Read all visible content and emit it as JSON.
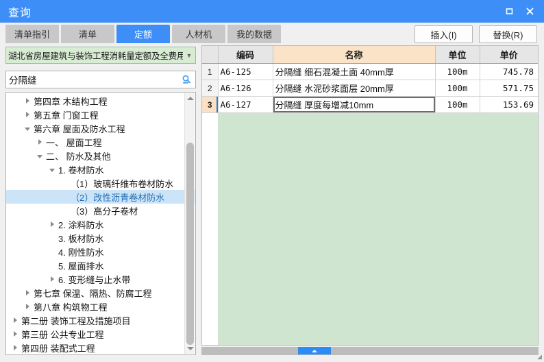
{
  "window": {
    "title": "查询",
    "controls": {
      "maximize": "maximize-icon",
      "close": "close-icon"
    }
  },
  "tabs": [
    {
      "label": "清单指引",
      "active": false
    },
    {
      "label": "清单",
      "active": false
    },
    {
      "label": "定额",
      "active": true
    },
    {
      "label": "人材机",
      "active": false
    },
    {
      "label": "我的数据",
      "active": false
    }
  ],
  "actions": {
    "insert": "插入(I)",
    "replace": "替换(R)"
  },
  "left": {
    "library_select": {
      "value": "湖北省房屋建筑与装饰工程消耗量定额及全费用",
      "arrow": "chevron-down-icon"
    },
    "search": {
      "value": "分隔缝",
      "placeholder": "",
      "icon": "search-icon"
    },
    "tree": [
      {
        "indent": 1,
        "state": "collapsed",
        "label": "第四章  木结构工程",
        "selected": false
      },
      {
        "indent": 1,
        "state": "collapsed",
        "label": "第五章  门窗工程",
        "selected": false
      },
      {
        "indent": 1,
        "state": "expanded",
        "label": "第六章  屋面及防水工程",
        "selected": false
      },
      {
        "indent": 2,
        "state": "collapsed",
        "label": "一、  屋面工程",
        "selected": false
      },
      {
        "indent": 2,
        "state": "expanded",
        "label": "二、  防水及其他",
        "selected": false
      },
      {
        "indent": 3,
        "state": "expanded",
        "label": "1.  卷材防水",
        "selected": false
      },
      {
        "indent": 4,
        "state": "leaf",
        "label": "（1）玻璃纤维布卷材防水",
        "selected": false
      },
      {
        "indent": 4,
        "state": "leaf",
        "label": "（2）改性沥青卷材防水",
        "selected": true
      },
      {
        "indent": 4,
        "state": "leaf",
        "label": "（3）高分子卷材",
        "selected": false
      },
      {
        "indent": 3,
        "state": "collapsed",
        "label": "2.  涂料防水",
        "selected": false
      },
      {
        "indent": 3,
        "state": "leaf",
        "label": "3.  板材防水",
        "selected": false
      },
      {
        "indent": 3,
        "state": "leaf",
        "label": "4.  刚性防水",
        "selected": false
      },
      {
        "indent": 3,
        "state": "leaf",
        "label": "5.  屋面排水",
        "selected": false
      },
      {
        "indent": 3,
        "state": "collapsed",
        "label": "6.  变形缝与止水带",
        "selected": false
      },
      {
        "indent": 1,
        "state": "collapsed",
        "label": "第七章  保温、隔热、防腐工程",
        "selected": false
      },
      {
        "indent": 1,
        "state": "collapsed",
        "label": "第八章  构筑物工程",
        "selected": false
      },
      {
        "indent": 0,
        "state": "collapsed",
        "label": "第二册  装饰工程及措施项目",
        "selected": false
      },
      {
        "indent": 0,
        "state": "collapsed",
        "label": "第三册  公共专业工程",
        "selected": false
      },
      {
        "indent": 0,
        "state": "collapsed",
        "label": "第四册  装配式工程",
        "selected": false
      }
    ],
    "scrollbar": {
      "up": "scroll-up-icon",
      "down": "scroll-down-icon"
    }
  },
  "grid": {
    "columns": [
      {
        "key": "idx",
        "label": ""
      },
      {
        "key": "code",
        "label": "编码"
      },
      {
        "key": "name",
        "label": "名称"
      },
      {
        "key": "unit",
        "label": "单位"
      },
      {
        "key": "price",
        "label": "单价"
      }
    ],
    "rows": [
      {
        "idx": "1",
        "code": "A6-125",
        "name": "分隔缝  细石混凝土面  40mm厚",
        "unit": "100m",
        "price": "745.78",
        "selected": false
      },
      {
        "idx": "2",
        "code": "A6-126",
        "name": "分隔缝  水泥砂浆面层  20mm厚",
        "unit": "100m",
        "price": "571.75",
        "selected": false
      },
      {
        "idx": "3",
        "code": "A6-127",
        "name": "分隔缝  厚度每增减10mm",
        "unit": "100m",
        "price": "153.69",
        "selected": true
      }
    ]
  },
  "bottom": {
    "handle": "collapse-handle-icon",
    "grip": "resize-grip-icon"
  },
  "colors": {
    "accent": "#3d8ef7",
    "tab_inactive": "#c8c8c8",
    "grid_fill": "#cfe5cf",
    "name_header": "#fbe3c8",
    "tree_selected": "#cce4f7",
    "combo_bg": "#d8ecd4"
  }
}
